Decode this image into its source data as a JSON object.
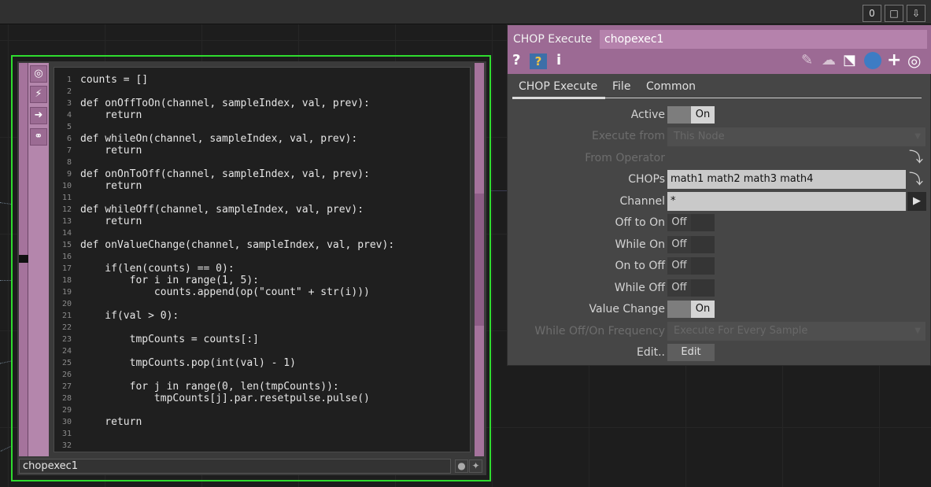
{
  "top_toolbar": {
    "buttons": [
      "0",
      "□",
      "⇩"
    ]
  },
  "node": {
    "name": "chopexec1",
    "strip_icons": [
      "target-icon",
      "pulse-icon",
      "arrow-right-icon",
      "python-icon"
    ],
    "code_lines": [
      {
        "n": "1",
        "t": "counts = []"
      },
      {
        "n": "2",
        "t": ""
      },
      {
        "n": "3",
        "t": "def onOffToOn(channel, sampleIndex, val, prev):"
      },
      {
        "n": "4",
        "t": "    return"
      },
      {
        "n": "5",
        "t": ""
      },
      {
        "n": "6",
        "t": "def whileOn(channel, sampleIndex, val, prev):"
      },
      {
        "n": "7",
        "t": "    return"
      },
      {
        "n": "8",
        "t": ""
      },
      {
        "n": "9",
        "t": "def onOnToOff(channel, sampleIndex, val, prev):"
      },
      {
        "n": "10",
        "t": "    return"
      },
      {
        "n": "11",
        "t": ""
      },
      {
        "n": "12",
        "t": "def whileOff(channel, sampleIndex, val, prev):"
      },
      {
        "n": "13",
        "t": "    return"
      },
      {
        "n": "14",
        "t": ""
      },
      {
        "n": "15",
        "t": "def onValueChange(channel, sampleIndex, val, prev):"
      },
      {
        "n": "16",
        "t": ""
      },
      {
        "n": "17",
        "t": "    if(len(counts) == 0):"
      },
      {
        "n": "18",
        "t": "        for i in range(1, 5):"
      },
      {
        "n": "19",
        "t": "            counts.append(op(\"count\" + str(i)))"
      },
      {
        "n": "20",
        "t": ""
      },
      {
        "n": "21",
        "t": "    if(val > 0):"
      },
      {
        "n": "22",
        "t": ""
      },
      {
        "n": "23",
        "t": "        tmpCounts = counts[:]"
      },
      {
        "n": "24",
        "t": ""
      },
      {
        "n": "25",
        "t": "        tmpCounts.pop(int(val) - 1)"
      },
      {
        "n": "26",
        "t": ""
      },
      {
        "n": "27",
        "t": "        for j in range(0, len(tmpCounts)):"
      },
      {
        "n": "28",
        "t": "            tmpCounts[j].par.resetpulse.pulse()"
      },
      {
        "n": "29",
        "t": ""
      },
      {
        "n": "30",
        "t": "    return"
      },
      {
        "n": "31",
        "t": ""
      },
      {
        "n": "32",
        "t": ""
      }
    ]
  },
  "panel": {
    "op_type": "CHOP Execute",
    "op_name": "chopexec1",
    "header_icons": {
      "help": "?",
      "python_help": "?",
      "info": "i"
    },
    "header_right_icons": [
      "pencil-icon",
      "comment-icon",
      "clone-icon",
      "python-icon",
      "plus-icon",
      "target-icon"
    ],
    "tabs": [
      "CHOP Execute",
      "File",
      "Common"
    ],
    "params": {
      "active": {
        "label": "Active",
        "value": "On"
      },
      "execute_from": {
        "label": "Execute from",
        "value": "This Node"
      },
      "from_operator": {
        "label": "From Operator"
      },
      "chops": {
        "label": "CHOPs",
        "value": "math1 math2 math3 math4"
      },
      "channel": {
        "label": "Channel",
        "value": "*"
      },
      "off_to_on": {
        "label": "Off to On",
        "value": "Off"
      },
      "while_on": {
        "label": "While On",
        "value": "Off"
      },
      "on_to_off": {
        "label": "On to Off",
        "value": "Off"
      },
      "while_off": {
        "label": "While Off",
        "value": "Off"
      },
      "value_change": {
        "label": "Value Change",
        "value": "On"
      },
      "frequency": {
        "label": "While Off/On Frequency",
        "value": "Execute For Every Sample"
      },
      "edit": {
        "label": "Edit..",
        "button": "Edit"
      }
    }
  }
}
